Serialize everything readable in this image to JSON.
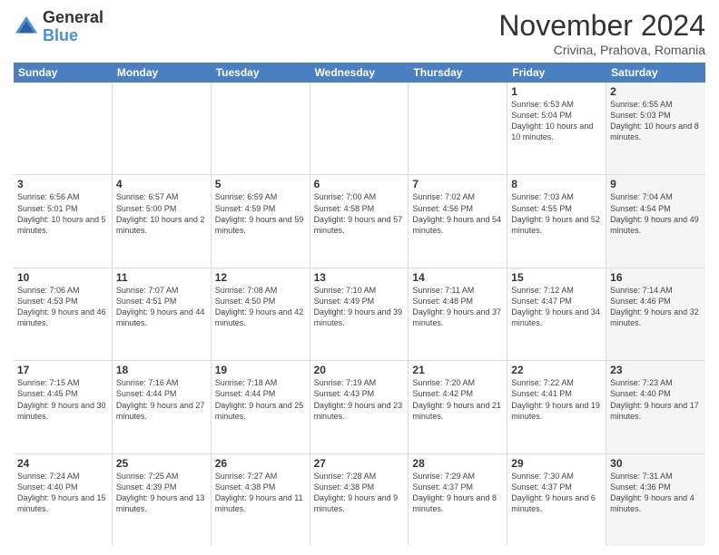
{
  "logo": {
    "general": "General",
    "blue": "Blue"
  },
  "header": {
    "month": "November 2024",
    "location": "Crivina, Prahova, Romania"
  },
  "weekdays": [
    "Sunday",
    "Monday",
    "Tuesday",
    "Wednesday",
    "Thursday",
    "Friday",
    "Saturday"
  ],
  "weeks": [
    [
      {
        "day": "",
        "info": "",
        "shaded": false
      },
      {
        "day": "",
        "info": "",
        "shaded": false
      },
      {
        "day": "",
        "info": "",
        "shaded": false
      },
      {
        "day": "",
        "info": "",
        "shaded": false
      },
      {
        "day": "",
        "info": "",
        "shaded": false
      },
      {
        "day": "1",
        "info": "Sunrise: 6:53 AM\nSunset: 5:04 PM\nDaylight: 10 hours and 10 minutes.",
        "shaded": false
      },
      {
        "day": "2",
        "info": "Sunrise: 6:55 AM\nSunset: 5:03 PM\nDaylight: 10 hours and 8 minutes.",
        "shaded": true
      }
    ],
    [
      {
        "day": "3",
        "info": "Sunrise: 6:56 AM\nSunset: 5:01 PM\nDaylight: 10 hours and 5 minutes.",
        "shaded": false
      },
      {
        "day": "4",
        "info": "Sunrise: 6:57 AM\nSunset: 5:00 PM\nDaylight: 10 hours and 2 minutes.",
        "shaded": false
      },
      {
        "day": "5",
        "info": "Sunrise: 6:59 AM\nSunset: 4:59 PM\nDaylight: 9 hours and 59 minutes.",
        "shaded": false
      },
      {
        "day": "6",
        "info": "Sunrise: 7:00 AM\nSunset: 4:58 PM\nDaylight: 9 hours and 57 minutes.",
        "shaded": false
      },
      {
        "day": "7",
        "info": "Sunrise: 7:02 AM\nSunset: 4:56 PM\nDaylight: 9 hours and 54 minutes.",
        "shaded": false
      },
      {
        "day": "8",
        "info": "Sunrise: 7:03 AM\nSunset: 4:55 PM\nDaylight: 9 hours and 52 minutes.",
        "shaded": false
      },
      {
        "day": "9",
        "info": "Sunrise: 7:04 AM\nSunset: 4:54 PM\nDaylight: 9 hours and 49 minutes.",
        "shaded": true
      }
    ],
    [
      {
        "day": "10",
        "info": "Sunrise: 7:06 AM\nSunset: 4:53 PM\nDaylight: 9 hours and 46 minutes.",
        "shaded": false
      },
      {
        "day": "11",
        "info": "Sunrise: 7:07 AM\nSunset: 4:51 PM\nDaylight: 9 hours and 44 minutes.",
        "shaded": false
      },
      {
        "day": "12",
        "info": "Sunrise: 7:08 AM\nSunset: 4:50 PM\nDaylight: 9 hours and 42 minutes.",
        "shaded": false
      },
      {
        "day": "13",
        "info": "Sunrise: 7:10 AM\nSunset: 4:49 PM\nDaylight: 9 hours and 39 minutes.",
        "shaded": false
      },
      {
        "day": "14",
        "info": "Sunrise: 7:11 AM\nSunset: 4:48 PM\nDaylight: 9 hours and 37 minutes.",
        "shaded": false
      },
      {
        "day": "15",
        "info": "Sunrise: 7:12 AM\nSunset: 4:47 PM\nDaylight: 9 hours and 34 minutes.",
        "shaded": false
      },
      {
        "day": "16",
        "info": "Sunrise: 7:14 AM\nSunset: 4:46 PM\nDaylight: 9 hours and 32 minutes.",
        "shaded": true
      }
    ],
    [
      {
        "day": "17",
        "info": "Sunrise: 7:15 AM\nSunset: 4:45 PM\nDaylight: 9 hours and 30 minutes.",
        "shaded": false
      },
      {
        "day": "18",
        "info": "Sunrise: 7:16 AM\nSunset: 4:44 PM\nDaylight: 9 hours and 27 minutes.",
        "shaded": false
      },
      {
        "day": "19",
        "info": "Sunrise: 7:18 AM\nSunset: 4:44 PM\nDaylight: 9 hours and 25 minutes.",
        "shaded": false
      },
      {
        "day": "20",
        "info": "Sunrise: 7:19 AM\nSunset: 4:43 PM\nDaylight: 9 hours and 23 minutes.",
        "shaded": false
      },
      {
        "day": "21",
        "info": "Sunrise: 7:20 AM\nSunset: 4:42 PM\nDaylight: 9 hours and 21 minutes.",
        "shaded": false
      },
      {
        "day": "22",
        "info": "Sunrise: 7:22 AM\nSunset: 4:41 PM\nDaylight: 9 hours and 19 minutes.",
        "shaded": false
      },
      {
        "day": "23",
        "info": "Sunrise: 7:23 AM\nSunset: 4:40 PM\nDaylight: 9 hours and 17 minutes.",
        "shaded": true
      }
    ],
    [
      {
        "day": "24",
        "info": "Sunrise: 7:24 AM\nSunset: 4:40 PM\nDaylight: 9 hours and 15 minutes.",
        "shaded": false
      },
      {
        "day": "25",
        "info": "Sunrise: 7:25 AM\nSunset: 4:39 PM\nDaylight: 9 hours and 13 minutes.",
        "shaded": false
      },
      {
        "day": "26",
        "info": "Sunrise: 7:27 AM\nSunset: 4:38 PM\nDaylight: 9 hours and 11 minutes.",
        "shaded": false
      },
      {
        "day": "27",
        "info": "Sunrise: 7:28 AM\nSunset: 4:38 PM\nDaylight: 9 hours and 9 minutes.",
        "shaded": false
      },
      {
        "day": "28",
        "info": "Sunrise: 7:29 AM\nSunset: 4:37 PM\nDaylight: 9 hours and 8 minutes.",
        "shaded": false
      },
      {
        "day": "29",
        "info": "Sunrise: 7:30 AM\nSunset: 4:37 PM\nDaylight: 9 hours and 6 minutes.",
        "shaded": false
      },
      {
        "day": "30",
        "info": "Sunrise: 7:31 AM\nSunset: 4:36 PM\nDaylight: 9 hours and 4 minutes.",
        "shaded": true
      }
    ]
  ]
}
